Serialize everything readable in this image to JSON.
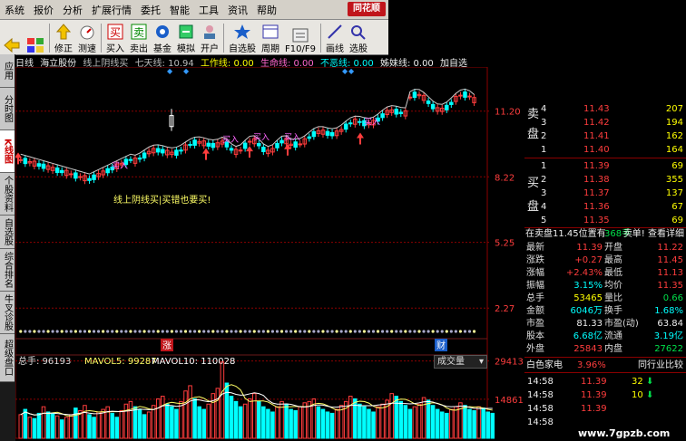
{
  "menu": [
    "系统",
    "报价",
    "分析",
    "扩展行情",
    "委托",
    "智能",
    "工具",
    "资讯",
    "帮助"
  ],
  "logo": "同花顺",
  "toolbar": [
    {
      "label": "修正",
      "icon": "arrow-up-icon"
    },
    {
      "label": "测速",
      "icon": "speed-icon"
    },
    {
      "label": "买入",
      "icon": "buy-icon"
    },
    {
      "label": "卖出",
      "icon": "sell-icon"
    },
    {
      "label": "基金",
      "icon": "fund-icon"
    },
    {
      "label": "模拟",
      "icon": "simulate-icon"
    },
    {
      "label": "开户",
      "icon": "open-account-icon"
    },
    {
      "label": "自选股",
      "icon": "favorites-icon"
    },
    {
      "label": "周期",
      "icon": "period-icon"
    },
    {
      "label": "F10/F9",
      "icon": "f10-icon"
    },
    {
      "label": "画线",
      "icon": "draw-line-icon"
    },
    {
      "label": "选股",
      "icon": "select-stock-icon"
    }
  ],
  "sidetabs": [
    "应用",
    "分时图",
    "K线图",
    "个股资料",
    "自选股",
    "综合排名",
    "牛叉诊股",
    "超级盘口"
  ],
  "info": {
    "period": "日线",
    "stock": "海立股份",
    "t1": "线上阴线买",
    "t2": "七天线: 10.94",
    "t3": "工作线: 0.00",
    "t4": "生命线: 0.00",
    "t5": "不恶线: 0.00",
    "t6": "姊妹线: 0.00",
    "t7": "加自选"
  },
  "chart_data": {
    "type": "candlestick",
    "y_ticks": [
      "11.20",
      "8.22",
      "5.25",
      "2.27"
    ],
    "y_tick_values": [
      11.2,
      8.22,
      5.25,
      2.27
    ],
    "ylim": [
      1.5,
      13.2
    ],
    "annotations": [
      "买入",
      "线上阴线买|买错也要买!"
    ],
    "markers": [
      "涨",
      "财"
    ],
    "volume": {
      "label": "总手: 96193",
      "ma5": "MAVOL5: 99287",
      "ma10": "MAVOL10: 110028",
      "indicator": "成交量",
      "y_ticks": [
        "29413",
        "14861"
      ],
      "y_tick_values": [
        29413,
        14861
      ],
      "ylim": [
        0,
        31000
      ],
      "values": [
        9000,
        11000,
        8000,
        7500,
        9500,
        12000,
        10000,
        9500,
        8500,
        7000,
        8000,
        9000,
        11500,
        10500,
        12500,
        9000,
        8000,
        10000,
        11000,
        12000,
        9500,
        8000,
        10500,
        13000,
        14000,
        12000,
        11000,
        9000,
        10000,
        12500,
        15000,
        16000,
        13000,
        12000,
        11000,
        14000,
        18000,
        20000,
        15000,
        12000,
        11000,
        13000,
        17000,
        19000,
        29000,
        21000,
        16000,
        14000,
        12000,
        13000,
        15000,
        17000,
        14000,
        12000,
        11000,
        10000,
        12000,
        14000,
        13000,
        11000,
        10500,
        12000,
        13500,
        14000,
        15000,
        12000,
        11000,
        10000,
        9500,
        11000,
        12500,
        14000,
        16000,
        15000,
        13000,
        12000,
        11000,
        10000,
        12000,
        13000,
        14500,
        17000,
        16000,
        14000,
        12500,
        11000,
        12000,
        13000,
        15500,
        14500,
        12500,
        11000,
        10000,
        9500,
        11000,
        12000,
        13500,
        12500,
        11000,
        10500,
        12000,
        11500,
        10000,
        9500
      ],
      "colors": [
        "r",
        "c",
        "r",
        "c",
        "c",
        "r",
        "c",
        "c",
        "r",
        "c",
        "r",
        "r",
        "c",
        "r",
        "r",
        "c",
        "c",
        "r",
        "r",
        "r",
        "c",
        "c",
        "r",
        "r",
        "r",
        "c",
        "c",
        "c",
        "r",
        "r",
        "r",
        "r",
        "c",
        "c",
        "c",
        "r",
        "r",
        "r",
        "c",
        "c",
        "c",
        "r",
        "r",
        "r",
        "r",
        "c",
        "c",
        "c",
        "c",
        "r",
        "r",
        "r",
        "c",
        "c",
        "c",
        "c",
        "r",
        "r",
        "c",
        "c",
        "c",
        "r",
        "r",
        "r",
        "r",
        "c",
        "c",
        "c",
        "c",
        "r",
        "r",
        "r",
        "r",
        "c",
        "c",
        "c",
        "c",
        "c",
        "r",
        "r",
        "r",
        "r",
        "c",
        "c",
        "c",
        "c",
        "r",
        "r",
        "r",
        "c",
        "c",
        "c",
        "c",
        "c",
        "r",
        "r",
        "r",
        "c",
        "c",
        "c",
        "r",
        "c",
        "c",
        "c"
      ]
    }
  },
  "quote": {
    "sell_label": [
      "卖",
      "盘"
    ],
    "buy_label": [
      "买",
      "盘"
    ],
    "sells": [
      {
        "n": "4",
        "p": "11.43",
        "v": "207"
      },
      {
        "n": "3",
        "p": "11.42",
        "v": "194"
      },
      {
        "n": "2",
        "p": "11.41",
        "v": "162"
      },
      {
        "n": "1",
        "p": "11.40",
        "v": "164"
      }
    ],
    "buys": [
      {
        "n": "1",
        "p": "11.39",
        "v": "69"
      },
      {
        "n": "2",
        "p": "11.38",
        "v": "355"
      },
      {
        "n": "3",
        "p": "11.37",
        "v": "137"
      },
      {
        "n": "4",
        "p": "11.36",
        "v": "67"
      },
      {
        "n": "5",
        "p": "11.35",
        "v": "69"
      }
    ],
    "order_info": "在卖盘11.45位置有",
    "order_qty": "368手",
    "order_link": "卖单! 查看详细",
    "stats": [
      {
        "l1": "最新",
        "v1": "11.39",
        "l2": "开盘",
        "v2": "11.22",
        "c1": "red",
        "c2": "red"
      },
      {
        "l1": "涨跌",
        "v1": "+0.27",
        "l2": "最高",
        "v2": "11.45",
        "c1": "red",
        "c2": "red"
      },
      {
        "l1": "涨幅",
        "v1": "+2.43%",
        "l2": "最低",
        "v2": "11.13",
        "c1": "red",
        "c2": "red"
      },
      {
        "l1": "振幅",
        "v1": "3.15%",
        "l2": "均价",
        "v2": "11.35",
        "c1": "cyan",
        "c2": "red"
      },
      {
        "l1": "总手",
        "v1": "53465",
        "l2": "量比",
        "v2": "0.66",
        "c1": "yellow",
        "c2": "green"
      },
      {
        "l1": "金额",
        "v1": "6046万",
        "l2": "换手",
        "v2": "1.68%",
        "c1": "cyan",
        "c2": "cyan"
      },
      {
        "l1": "市盈",
        "v1": "81.33",
        "l2": "市盈(动)",
        "v2": "63.84",
        "c1": "white",
        "c2": "white"
      },
      {
        "l1": "股本",
        "v1": "6.68亿",
        "l2": "流通",
        "v2": "3.19亿",
        "c1": "cyan",
        "c2": "cyan"
      },
      {
        "l1": "外盘",
        "v1": "25843",
        "l2": "内盘",
        "v2": "27622",
        "c1": "red",
        "c2": "green"
      }
    ],
    "sector": "白色家电",
    "sector_pct": "3.96%",
    "sector_link": "同行业比较",
    "ticks": [
      {
        "t": "14:58",
        "p": "11.39",
        "v": "32",
        "dir": "down"
      },
      {
        "t": "14:58",
        "p": "11.39",
        "v": "10",
        "dir": "down"
      },
      {
        "t": "14:58",
        "p": "11.39",
        "v": "",
        "dir": ""
      },
      {
        "t": "14:58",
        "p": "",
        "v": "",
        "dir": ""
      }
    ]
  },
  "watermark": "www.7gpzb.com",
  "colors": {
    "up": "#ff3d3d",
    "down": "#00ffff",
    "ma": "#cccccc",
    "vol_up": "#ff3d3d",
    "vol_down": "#00ffff",
    "grid": "#8b0000"
  }
}
